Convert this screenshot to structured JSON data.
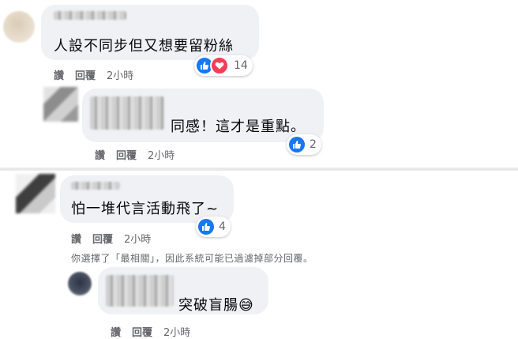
{
  "comments": [
    {
      "text": "人設不同步但又想要留粉絲",
      "reaction_count": "14"
    },
    {
      "text": "同感！這才是重點。",
      "reaction_count": "2"
    },
    {
      "text": "怕一堆代言活動飛了~",
      "reaction_count": "4"
    },
    {
      "text": "突破盲腸",
      "emoji": "😅"
    }
  ],
  "actions": {
    "like": "讚",
    "reply": "回覆",
    "time": "2小時"
  },
  "filter_notice": "你選擇了「最相關」，因此系統可能已過濾掉部分回覆。",
  "colors": {
    "like_blue": "#1877f2",
    "love_red": "#f33e58",
    "bubble_bg": "#eff1f5",
    "meta_gray": "#65676b"
  }
}
